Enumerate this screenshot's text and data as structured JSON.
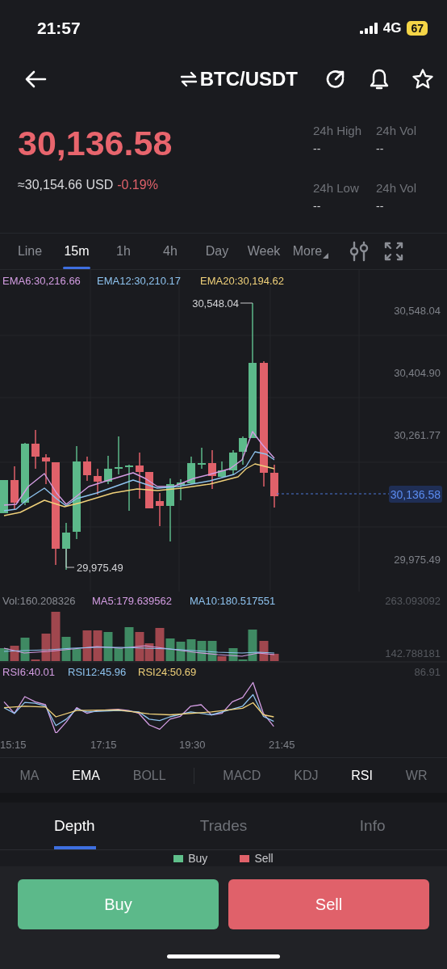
{
  "status_bar": {
    "time": "21:57",
    "network": "4G",
    "battery": "67"
  },
  "header": {
    "pair": "BTC/USDT"
  },
  "price": {
    "last": "30,136.58",
    "fiat": "≈30,154.66 USD",
    "change": "-0.19%"
  },
  "stats": [
    {
      "label": "24h High",
      "value": "--"
    },
    {
      "label": "24h Vol",
      "value": "--"
    },
    {
      "label": "24h Low",
      "value": "--"
    },
    {
      "label": "24h Vol",
      "value": "--"
    }
  ],
  "intervals": [
    {
      "label": "Line",
      "selected": false,
      "kind": "interval"
    },
    {
      "label": "15m",
      "selected": true,
      "kind": "interval"
    },
    {
      "label": "1h",
      "selected": false,
      "kind": "interval"
    },
    {
      "label": "4h",
      "selected": false,
      "kind": "interval"
    },
    {
      "label": "Day",
      "selected": false,
      "kind": "interval"
    },
    {
      "label": "Week",
      "selected": false,
      "kind": "interval"
    },
    {
      "label": "More",
      "selected": false,
      "kind": "menu"
    }
  ],
  "main_chart": {
    "legend": [
      {
        "text": "EMA6:30,216.66",
        "color": "#d49de3"
      },
      {
        "text": "EMA12:30,210.17",
        "color": "#8ec3ef"
      },
      {
        "text": "EMA20:30,194.62",
        "color": "#f0d17a"
      }
    ],
    "y_labels": [
      "30,548.04",
      "30,404.90",
      "30,261.77",
      "29,975.49"
    ],
    "current_price": "30,136.58",
    "high_marker": "30,548.04",
    "low_marker": "29,975.49"
  },
  "volume_chart": {
    "legend": [
      {
        "text": "Vol:160.208326",
        "color": "#8a8d94"
      },
      {
        "text": "MA5:179.639562",
        "color": "#d49de3"
      },
      {
        "text": "MA10:180.517551",
        "color": "#8ec3ef"
      }
    ],
    "y_labels": [
      "263.093092",
      "142.788181"
    ]
  },
  "rsi_chart": {
    "legend": [
      {
        "text": "RSI6:40.01",
        "color": "#d49de3"
      },
      {
        "text": "RSI12:45.96",
        "color": "#8ec3ef"
      },
      {
        "text": "RSI24:50.69",
        "color": "#f0d17a"
      }
    ],
    "y_labels": [
      "86.91"
    ]
  },
  "time_labels": [
    "15:15",
    "17:15",
    "19:30",
    "21:45"
  ],
  "indicators": {
    "main": [
      {
        "label": "MA",
        "selected": false
      },
      {
        "label": "EMA",
        "selected": true
      },
      {
        "label": "BOLL",
        "selected": false
      }
    ],
    "sub": [
      {
        "label": "MACD",
        "selected": false
      },
      {
        "label": "KDJ",
        "selected": false
      },
      {
        "label": "RSI",
        "selected": true
      },
      {
        "label": "WR",
        "selected": false
      }
    ]
  },
  "detail_tabs": [
    {
      "label": "Depth",
      "selected": true
    },
    {
      "label": "Trades",
      "selected": false
    },
    {
      "label": "Info",
      "selected": false
    }
  ],
  "depth_legend": [
    {
      "label": "Buy",
      "color": "#5fbf8a"
    },
    {
      "label": "Sell",
      "color": "#e0626a"
    }
  ],
  "actions": [
    {
      "label": "Buy",
      "kind": "buy"
    },
    {
      "label": "Sell",
      "kind": "sell"
    }
  ]
}
